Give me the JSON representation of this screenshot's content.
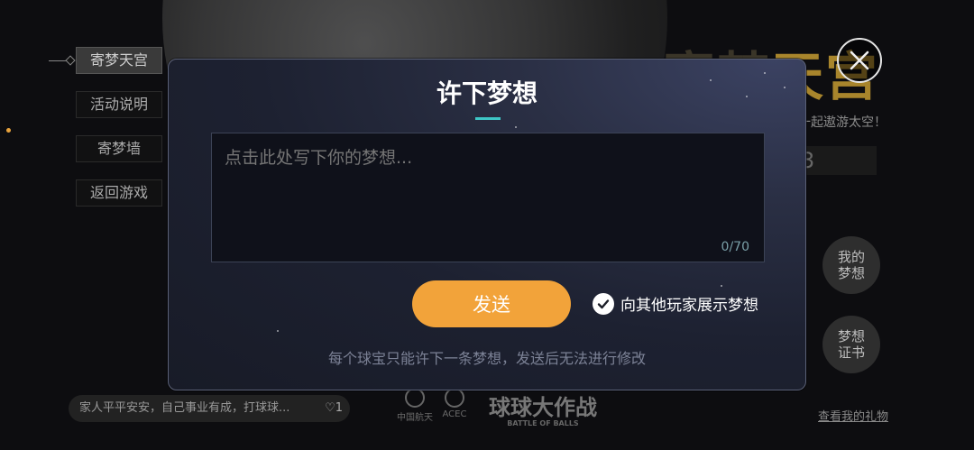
{
  "side_menu": {
    "items": [
      {
        "label": "寄梦天宫",
        "active": true
      },
      {
        "label": "活动说明",
        "active": false
      },
      {
        "label": "寄梦墙",
        "active": false
      },
      {
        "label": "返回游戏",
        "active": false
      }
    ]
  },
  "background": {
    "title_part1": "寄梦",
    "title_part2": "天宫",
    "subtitle": "一起遨游太空！",
    "counter_digit": "3",
    "my_dream_label": "我的梦想",
    "dream_cert_label": "梦想证书",
    "gift_link": "查看我的礼物",
    "bottom_message": "家人平平安安，自己事业有成，打球球...",
    "like_count": "1",
    "logo1_text": "中国航天",
    "logo2_text": "ACEC",
    "logo3_text": "球球大作战",
    "logo3_sub": "BATTLE OF BALLS"
  },
  "dialog": {
    "title": "许下梦想",
    "input_placeholder": "点击此处写下你的梦想...",
    "char_counter": "0/70",
    "send_label": "发送",
    "show_to_others_label": "向其他玩家展示梦想",
    "show_to_others_checked": true,
    "note": "每个球宝只能许下一条梦想，发送后无法进行修改"
  },
  "colors": {
    "accent": "#f2a33a",
    "title_underline": "#3ec6c6"
  },
  "icons": {
    "close": "close-icon",
    "check": "check-icon",
    "like": "heart-icon"
  }
}
